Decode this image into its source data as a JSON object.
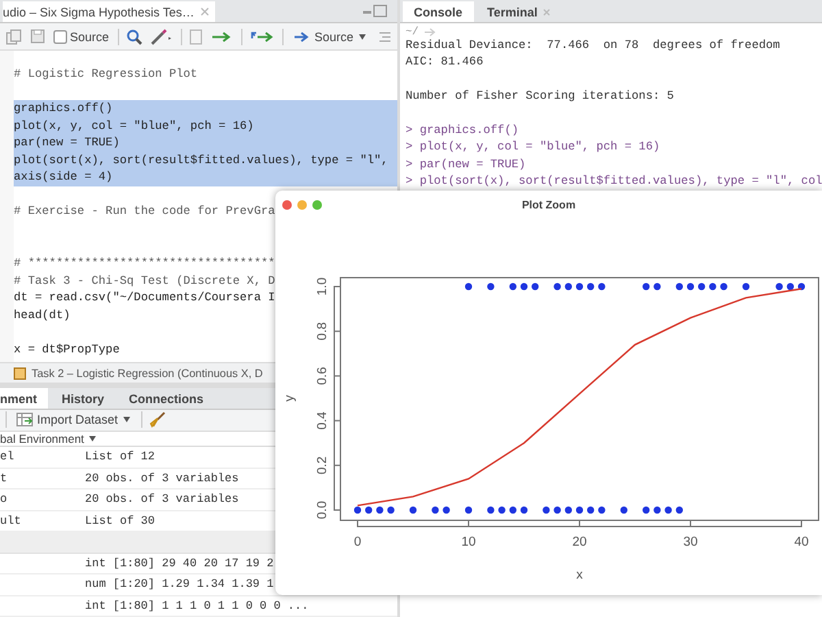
{
  "editor": {
    "tab": {
      "title": "udio – Six Sigma Hypothesis Tes…",
      "selected": true
    },
    "toolbar": {
      "source_on_save": {
        "label": "Source",
        "checked": false
      },
      "source_button": "Source"
    },
    "lines": [
      {
        "kind": "comment",
        "text": "# Logistic Regression Plot",
        "selected": false
      },
      {
        "kind": "blank",
        "selected": false
      },
      {
        "kind": "code",
        "text": "graphics.off()",
        "selected": true
      },
      {
        "kind": "code",
        "text": "plot(x, y, col = \"blue\", pch = 16)",
        "selected": true
      },
      {
        "kind": "code",
        "text": "par(new = TRUE)",
        "selected": true
      },
      {
        "kind": "code",
        "text": "plot(sort(x), sort(result$fitted.values), type = \"l\",",
        "selected": true
      },
      {
        "kind": "code",
        "text": "axis(side = 4)",
        "selected": true
      },
      {
        "kind": "blank",
        "selected": false
      },
      {
        "kind": "comment",
        "text": "# Exercise - Run the code for PrevGra",
        "selected": false
      },
      {
        "kind": "blank",
        "selected": false
      },
      {
        "kind": "blank",
        "selected": false
      },
      {
        "kind": "comment",
        "text": "# ***********************************",
        "selected": false
      },
      {
        "kind": "comment",
        "text": "# Task 3 - Chi-Sq Test (Discrete X, D",
        "selected": false
      },
      {
        "kind": "code",
        "text": "dt = read.csv(\"~/Documents/Coursera I",
        "selected": false
      },
      {
        "kind": "code",
        "text": "head(dt)",
        "selected": false
      },
      {
        "kind": "blank",
        "selected": false
      },
      {
        "kind": "code",
        "text": "x = dt$PropType",
        "selected": false
      }
    ],
    "status": "Task 2 – Logistic Regression (Continuous X, D"
  },
  "environment": {
    "tabs": [
      {
        "label": "nment",
        "selected": true
      },
      {
        "label": "History",
        "selected": false
      },
      {
        "label": "Connections",
        "selected": false
      }
    ],
    "import_button": "Import Dataset",
    "scope": "bal Environment",
    "rows": [
      {
        "kind": "data",
        "name": "el",
        "value": "List of 12"
      },
      {
        "kind": "data",
        "name": "t",
        "value": "20 obs. of 3 variables"
      },
      {
        "kind": "data",
        "name": "o",
        "value": "20 obs. of 3 variables"
      },
      {
        "kind": "data",
        "name": "ult",
        "value": "List of 30"
      },
      {
        "kind": "section"
      },
      {
        "kind": "value",
        "value": "int [1:80] 29 40 20 17 19 2"
      },
      {
        "kind": "value",
        "value": "num [1:20] 1.29 1.34 1.39 1"
      },
      {
        "kind": "value",
        "value": "int [1:80] 1 1 1 0 1 1 0 0 0 ..."
      }
    ]
  },
  "console": {
    "tabs": [
      {
        "label": "Console",
        "selected": true,
        "closable": false
      },
      {
        "label": "Terminal",
        "selected": false,
        "closable": true
      }
    ],
    "path": "~/",
    "lines": [
      {
        "kind": "output",
        "text": "Residual Deviance:  77.466  on 78  degrees of freedom"
      },
      {
        "kind": "output",
        "text": "AIC: 81.466"
      },
      {
        "kind": "blank"
      },
      {
        "kind": "output",
        "text": "Number of Fisher Scoring iterations: 5"
      },
      {
        "kind": "blank"
      },
      {
        "kind": "command",
        "text": "> graphics.off()"
      },
      {
        "kind": "command",
        "text": "> plot(x, y, col = \"blue\", pch = 16)"
      },
      {
        "kind": "command",
        "text": "> par(new = TRUE)"
      },
      {
        "kind": "command",
        "text": "> plot(sort(x), sort(result$fitted.values), type = \"l\", col"
      }
    ]
  },
  "plot_window": {
    "title": "Plot Zoom",
    "chart_data": {
      "type": "scatter",
      "xlabel": "x",
      "ylabel": "y",
      "series": [
        {
          "color": "#1f35e0",
          "x": [
            10,
            12,
            14,
            15,
            16,
            18,
            19,
            20,
            21,
            22,
            26,
            27,
            29,
            30,
            31,
            32,
            33,
            35,
            38,
            39,
            40
          ],
          "values": [
            1,
            1,
            1,
            1,
            1,
            1,
            1,
            1,
            1,
            1,
            1,
            1,
            1,
            1,
            1,
            1,
            1,
            1,
            1,
            1,
            1
          ]
        },
        {
          "color": "#1f35e0",
          "x": [
            0,
            1,
            2,
            3,
            5,
            7,
            8,
            10,
            12,
            13,
            14,
            15,
            17,
            18,
            19,
            20,
            21,
            22,
            24,
            26,
            27,
            28,
            29
          ],
          "values": [
            0,
            0,
            0,
            0,
            0,
            0,
            0,
            0,
            0,
            0,
            0,
            0,
            0,
            0,
            0,
            0,
            0,
            0,
            0,
            0,
            0,
            0,
            0
          ]
        },
        {
          "type": "line",
          "color": "#d7382c",
          "x": [
            0,
            5,
            10,
            15,
            20,
            25,
            30,
            35,
            40
          ],
          "values": [
            0.02,
            0.06,
            0.14,
            0.3,
            0.52,
            0.74,
            0.86,
            0.95,
            0.99
          ]
        }
      ],
      "xlim": [
        0,
        40
      ],
      "ylim": [
        0,
        1
      ],
      "xticks": [
        0,
        10,
        20,
        30,
        40
      ],
      "yticks": [
        {
          "value": 0,
          "label": "0.0"
        },
        {
          "value": 0.2,
          "label": "0.2"
        },
        {
          "value": 0.4,
          "label": "0.4"
        },
        {
          "value": 0.6,
          "label": "0.6"
        },
        {
          "value": 0.8,
          "label": "0.8"
        },
        {
          "value": 1,
          "label": "1.0"
        }
      ]
    }
  }
}
